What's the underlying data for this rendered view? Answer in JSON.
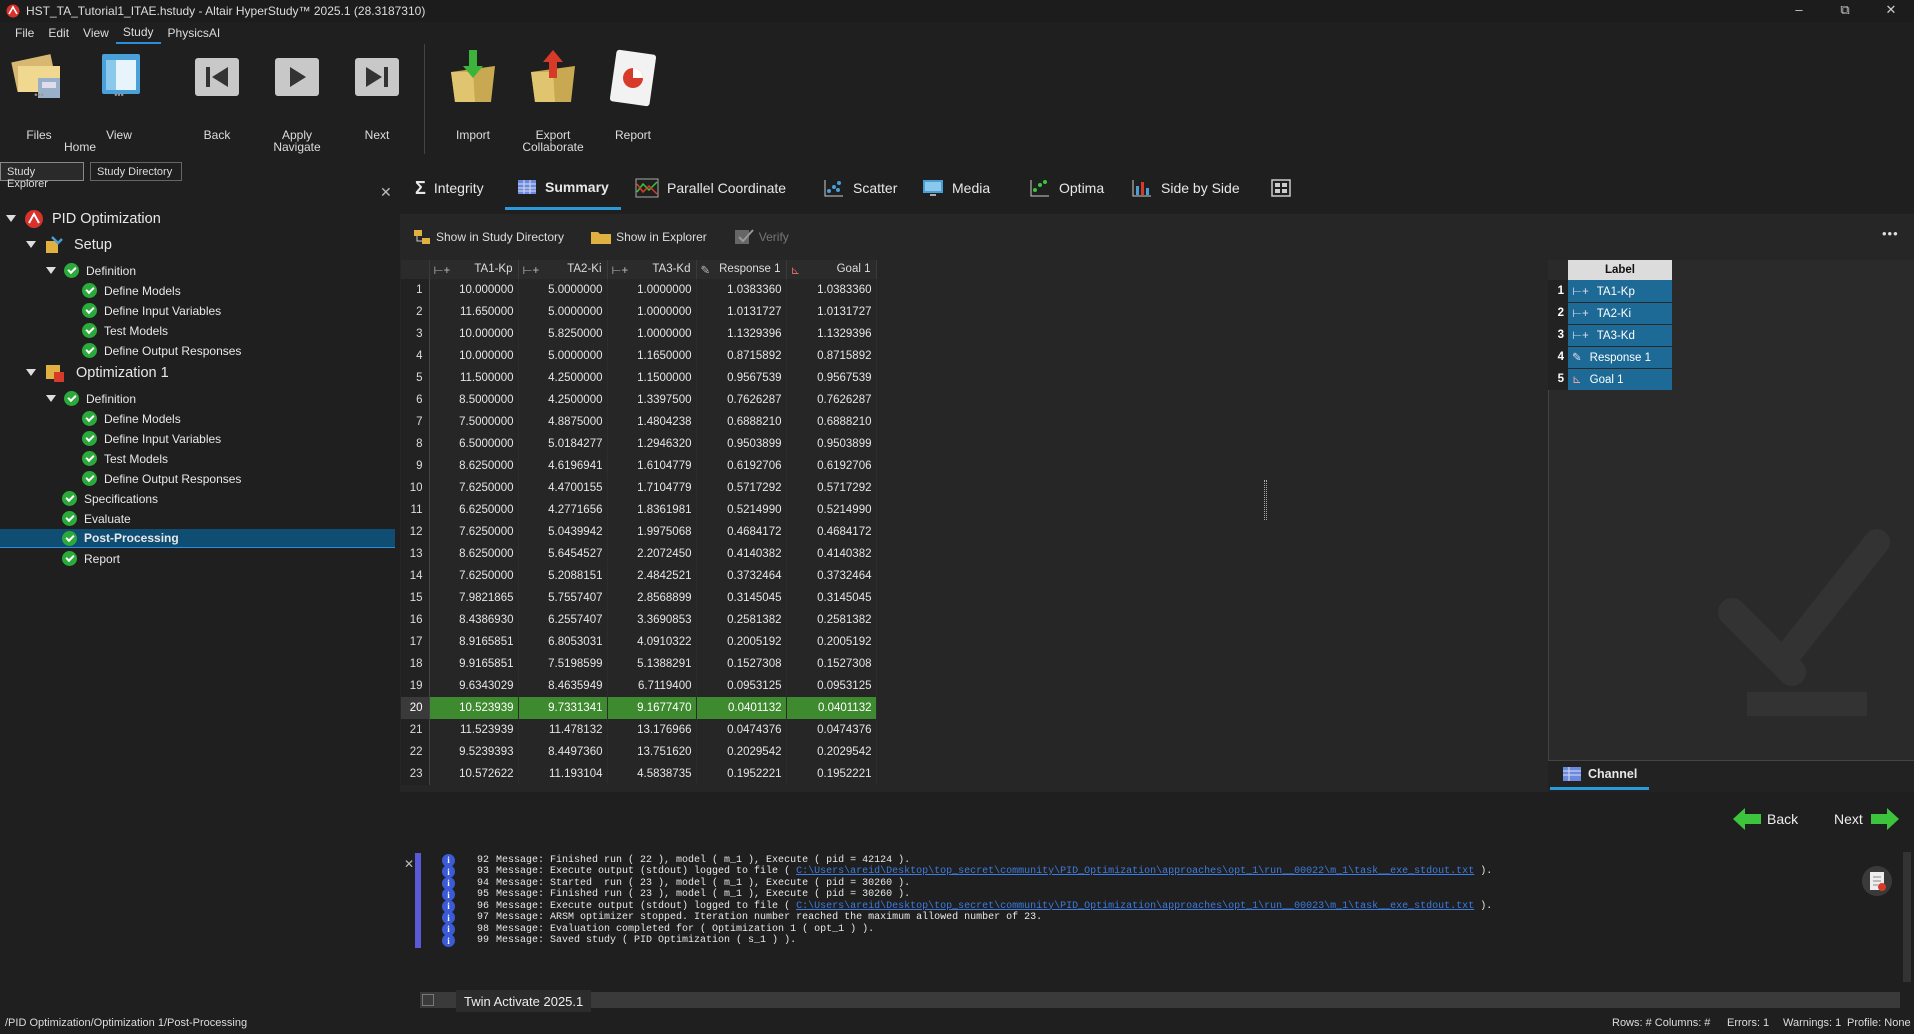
{
  "window": {
    "title": "HST_TA_Tutorial1_ITAE.hstudy - Altair HyperStudy™ 2025.1 (28.3187310)",
    "controls": [
      "–",
      "⧉",
      "✕"
    ]
  },
  "menu": [
    "File",
    "Edit",
    "View",
    "Study",
    "PhysicsAI"
  ],
  "ribbon": {
    "files": "Files",
    "view": "View",
    "home": "Home",
    "back": "Back",
    "apply": "Apply",
    "navigate": "Navigate",
    "next": "Next",
    "import": "Import",
    "export": "Export",
    "collaborate": "Collaborate",
    "report": "Report",
    "dots": "•••"
  },
  "left_tabs": [
    "Study Explorer",
    "Study Directory"
  ],
  "tree": {
    "root": "PID Optimization",
    "setup": "Setup",
    "setup_definition": "Definition",
    "setup_items": [
      "Define Models",
      "Define Input Variables",
      "Test Models",
      "Define Output Responses"
    ],
    "opt": "Optimization 1",
    "opt_definition": "Definition",
    "opt_items": [
      "Define Models",
      "Define Input Variables",
      "Test Models",
      "Define Output Responses"
    ],
    "specifications": "Specifications",
    "evaluate": "Evaluate",
    "post_processing": "Post-Processing",
    "report": "Report"
  },
  "view_tabs": [
    "Integrity",
    "Summary",
    "Parallel Coordinate",
    "Scatter",
    "Media",
    "Optima",
    "Side by Side"
  ],
  "toolbar": {
    "show_study_dir": "Show in Study Directory",
    "show_explorer": "Show in Explorer",
    "verify": "Verify",
    "more": "•••"
  },
  "table": {
    "headers": [
      "TA1-Kp",
      "TA2-Ki",
      "TA3-Kd",
      "Response 1",
      "Goal 1"
    ],
    "rows": [
      [
        "1",
        "10.000000",
        "5.0000000",
        "1.0000000",
        "1.0383360",
        "1.0383360"
      ],
      [
        "2",
        "11.650000",
        "5.0000000",
        "1.0000000",
        "1.0131727",
        "1.0131727"
      ],
      [
        "3",
        "10.000000",
        "5.8250000",
        "1.0000000",
        "1.1329396",
        "1.1329396"
      ],
      [
        "4",
        "10.000000",
        "5.0000000",
        "1.1650000",
        "0.8715892",
        "0.8715892"
      ],
      [
        "5",
        "11.500000",
        "4.2500000",
        "1.1500000",
        "0.9567539",
        "0.9567539"
      ],
      [
        "6",
        "8.5000000",
        "4.2500000",
        "1.3397500",
        "0.7626287",
        "0.7626287"
      ],
      [
        "7",
        "7.5000000",
        "4.8875000",
        "1.4804238",
        "0.6888210",
        "0.6888210"
      ],
      [
        "8",
        "6.5000000",
        "5.0184277",
        "1.2946320",
        "0.9503899",
        "0.9503899"
      ],
      [
        "9",
        "8.6250000",
        "4.6196941",
        "1.6104779",
        "0.6192706",
        "0.6192706"
      ],
      [
        "10",
        "7.6250000",
        "4.4700155",
        "1.7104779",
        "0.5717292",
        "0.5717292"
      ],
      [
        "11",
        "6.6250000",
        "4.2771656",
        "1.8361981",
        "0.5214990",
        "0.5214990"
      ],
      [
        "12",
        "7.6250000",
        "5.0439942",
        "1.9975068",
        "0.4684172",
        "0.4684172"
      ],
      [
        "13",
        "8.6250000",
        "5.6454527",
        "2.2072450",
        "0.4140382",
        "0.4140382"
      ],
      [
        "14",
        "7.6250000",
        "5.2088151",
        "2.4842521",
        "0.3732464",
        "0.3732464"
      ],
      [
        "15",
        "7.9821865",
        "5.7557407",
        "2.8568899",
        "0.3145045",
        "0.3145045"
      ],
      [
        "16",
        "8.4386930",
        "6.2557407",
        "3.3690853",
        "0.2581382",
        "0.2581382"
      ],
      [
        "17",
        "8.9165851",
        "6.8053031",
        "4.0910322",
        "0.2005192",
        "0.2005192"
      ],
      [
        "18",
        "9.9165851",
        "7.5198599",
        "5.1388291",
        "0.1527308",
        "0.1527308"
      ],
      [
        "19",
        "9.6343029",
        "8.4635949",
        "6.7119400",
        "0.0953125",
        "0.0953125"
      ],
      [
        "20",
        "10.523939",
        "9.7331341",
        "9.1677470",
        "0.0401132",
        "0.0401132"
      ],
      [
        "21",
        "11.523939",
        "11.478132",
        "13.176966",
        "0.0474376",
        "0.0474376"
      ],
      [
        "22",
        "9.5239393",
        "8.4497360",
        "13.751620",
        "0.2029542",
        "0.2029542"
      ],
      [
        "23",
        "10.572622",
        "11.193104",
        "4.5838735",
        "0.1952221",
        "0.1952221"
      ]
    ],
    "highlighted_row": 20
  },
  "label_panel": {
    "header": "Label",
    "items": [
      "TA1-Kp",
      "TA2-Ki",
      "TA3-Kd",
      "Response 1",
      "Goal 1"
    ],
    "numbers": [
      "1",
      "2",
      "3",
      "4",
      "5"
    ],
    "channel_tab": "Channel"
  },
  "nav": {
    "back": "Back",
    "next": "Next"
  },
  "log": [
    {
      "n": "92",
      "pre": "Message: Finished run ( 22 ), model ( m_1 ), Execute ( pid = 42124 ).",
      "link": "",
      "post": ""
    },
    {
      "n": "93",
      "pre": "Message: Execute output (stdout) logged to file ( ",
      "link": "C:\\Users\\areid\\Desktop\\top_secret\\community\\PID_Optimization\\approaches\\opt_1\\run__00022\\m_1\\task__exe_stdout.txt",
      "post": " )."
    },
    {
      "n": "94",
      "pre": "Message: Started  run ( 23 ), model ( m_1 ), Execute ( pid = 30260 ).",
      "link": "",
      "post": ""
    },
    {
      "n": "95",
      "pre": "Message: Finished run ( 23 ), model ( m_1 ), Execute ( pid = 30260 ).",
      "link": "",
      "post": ""
    },
    {
      "n": "96",
      "pre": "Message: Execute output (stdout) logged to file ( ",
      "link": "C:\\Users\\areid\\Desktop\\top_secret\\community\\PID_Optimization\\approaches\\opt_1\\run__00023\\m_1\\task__exe_stdout.txt",
      "post": " )."
    },
    {
      "n": "97",
      "pre": "Message: ARSM optimizer stopped. Iteration number reached the maximum allowed number of 23.",
      "link": "",
      "post": ""
    },
    {
      "n": "98",
      "pre": "Message: Evaluation completed for ( Optimization 1 ( opt_1 ) ).",
      "link": "",
      "post": ""
    },
    {
      "n": "99",
      "pre": "Message: Saved study ( PID Optimization ( s_1 ) ).",
      "link": "",
      "post": ""
    }
  ],
  "bottom_tab": "Twin Activate 2025.1",
  "status": {
    "path": "/PID Optimization/Optimization 1/Post-Processing",
    "rows_cols": "Rows: # Columns: #",
    "errors": "Errors: 1",
    "warnings": "Warnings: 1",
    "profile": "Profile: None"
  },
  "colors": {
    "accent": "#2a9ad8",
    "selection": "#0f4d73",
    "highlight_row": "#3e8a2e",
    "ok_green": "#2aaa3a",
    "nav_arrow": "#3cc43c"
  }
}
